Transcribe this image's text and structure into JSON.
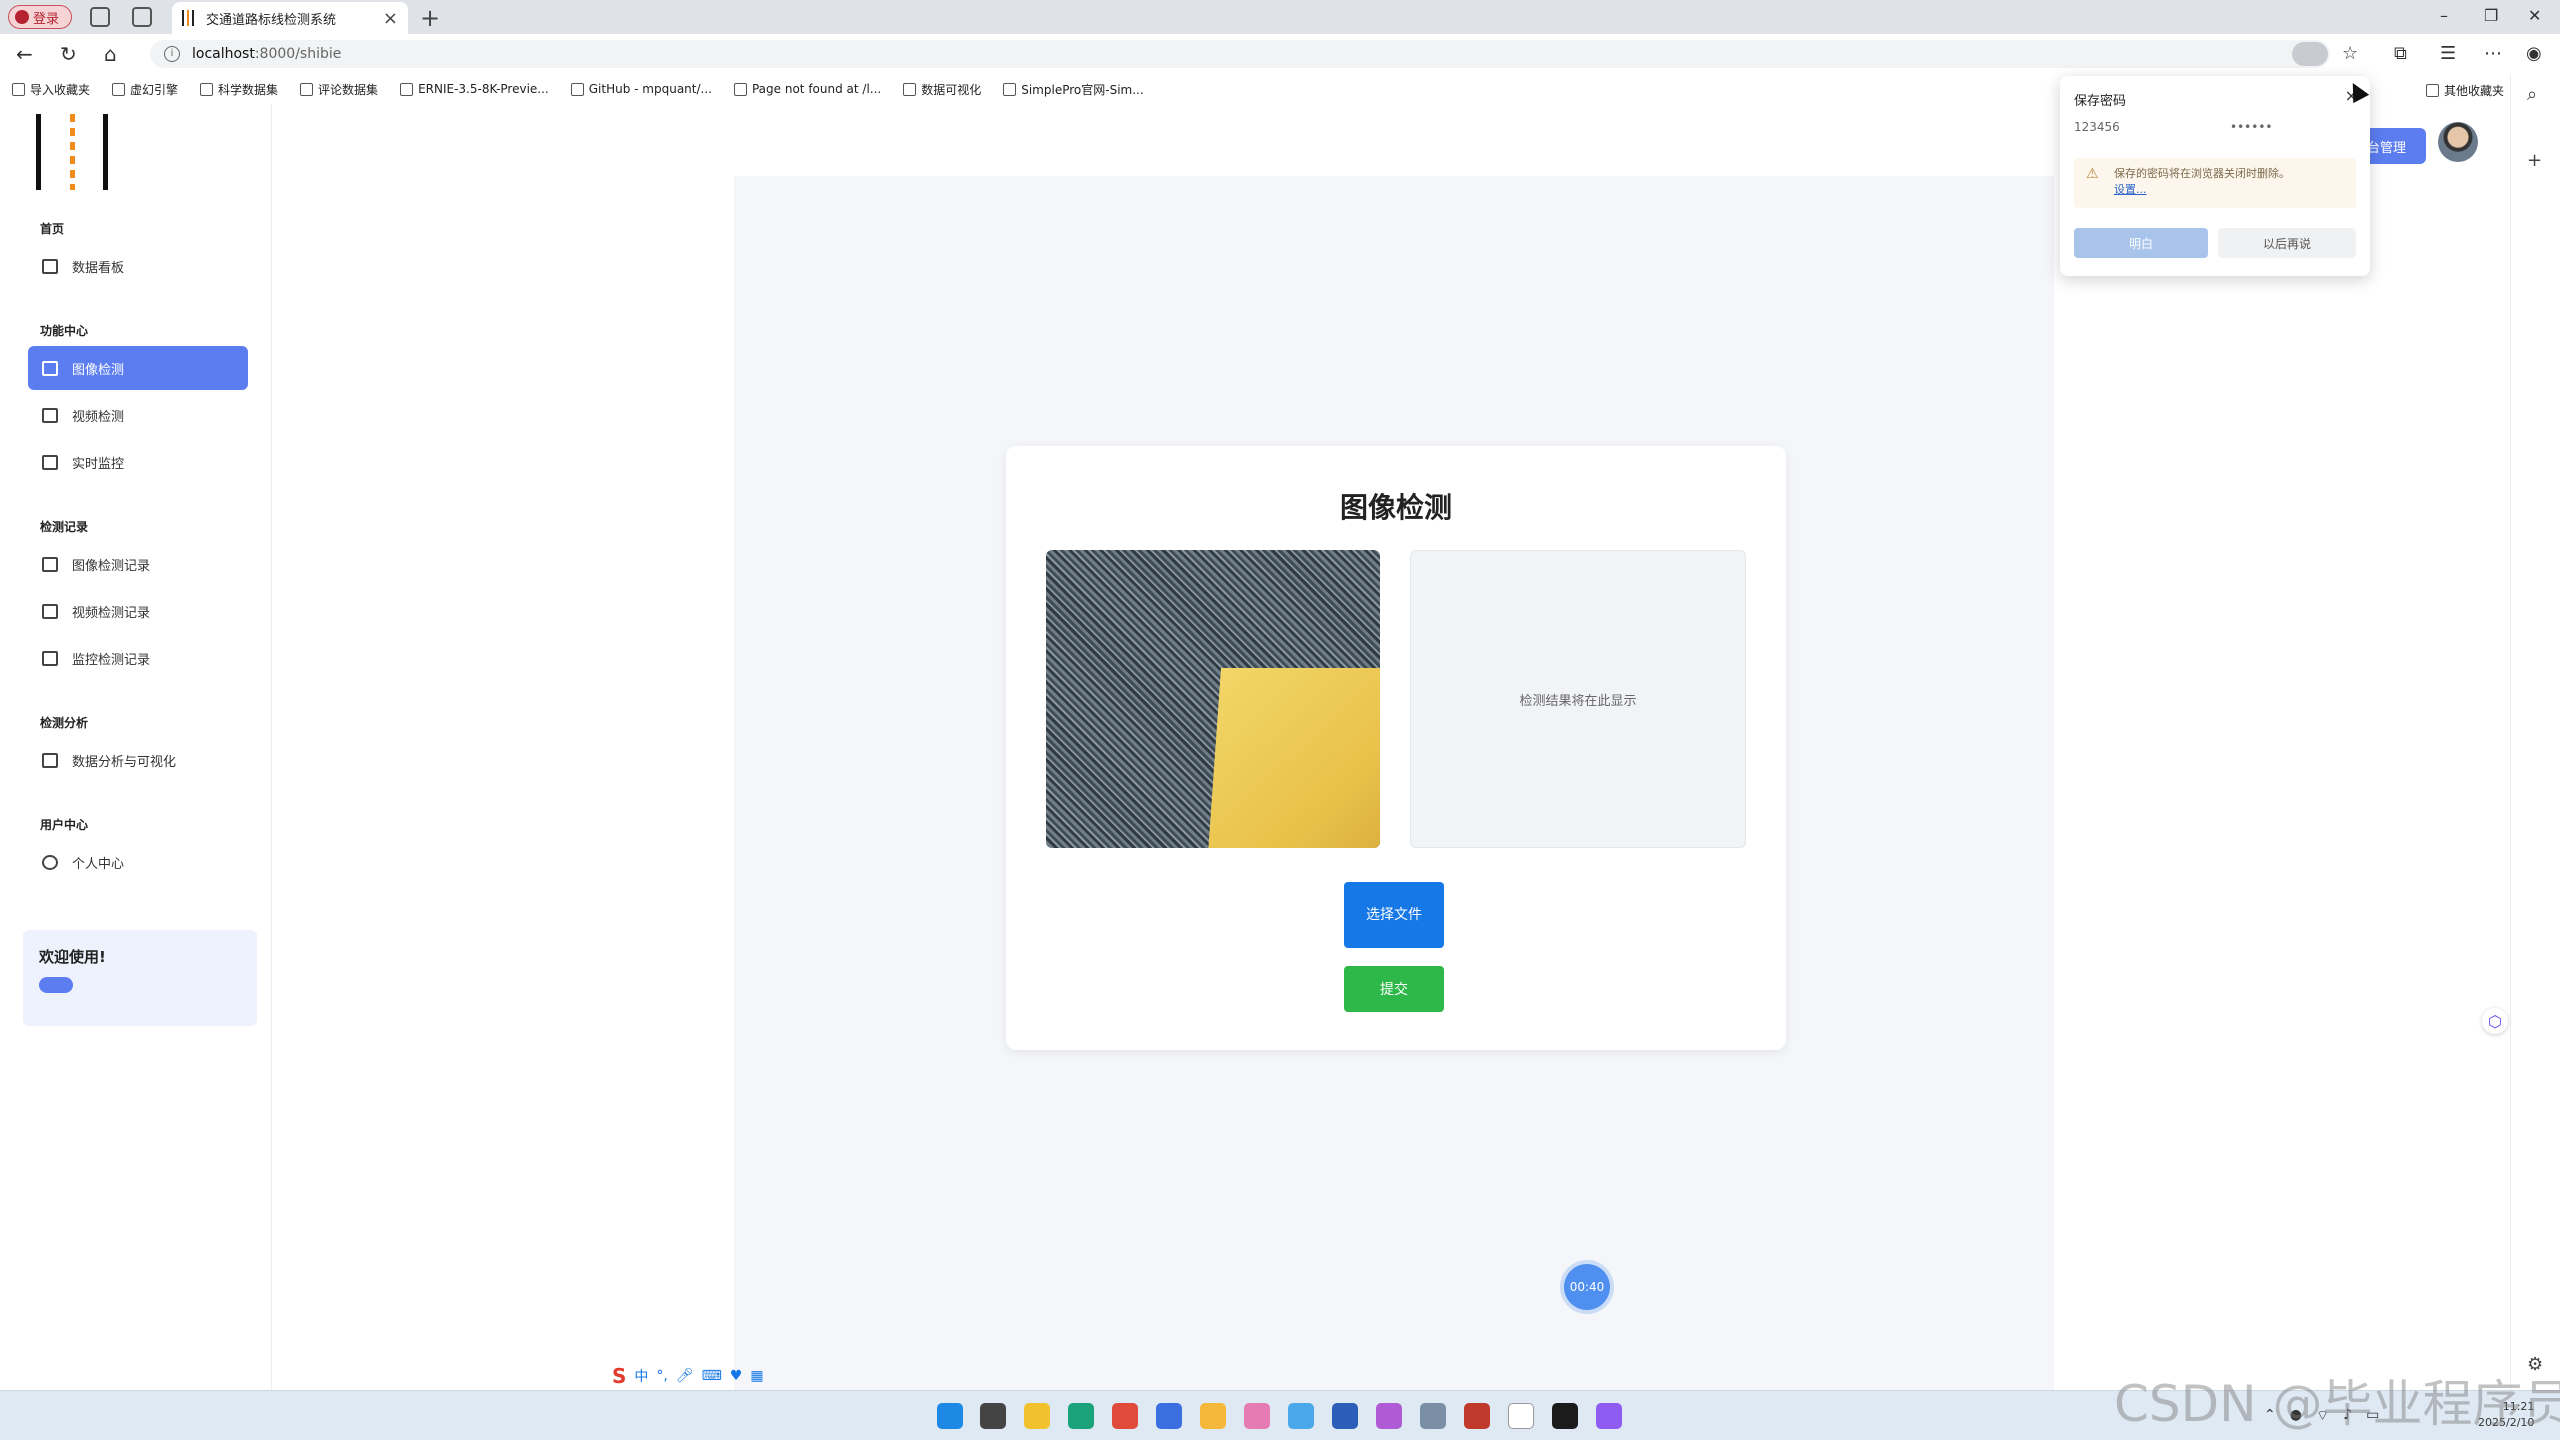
{
  "browser": {
    "profile_label": "登录",
    "tab_title": "交通道路标线检测系统",
    "url_host": "localhost",
    "url_path": ":8000/shibie",
    "bookmarks": [
      "导入收藏夹",
      "虚幻引擎",
      "科学数据集",
      "评论数据集",
      "ERNIE-3.5-8K-Previe...",
      "GitHub - mpquant/...",
      "Page not found at /l...",
      "数据可视化",
      "SimplePro官网-Sim..."
    ],
    "other_bookmarks": "其他收藏夹"
  },
  "sidebar": {
    "sections": [
      {
        "title": "首页",
        "items": [
          {
            "label": "数据看板"
          }
        ]
      },
      {
        "title": "功能中心",
        "items": [
          {
            "label": "图像检测"
          },
          {
            "label": "视频检测"
          },
          {
            "label": "实时监控"
          }
        ]
      },
      {
        "title": "检测记录",
        "items": [
          {
            "label": "图像检测记录"
          },
          {
            "label": "视频检测记录"
          },
          {
            "label": "监控检测记录"
          }
        ]
      },
      {
        "title": "检测分析",
        "items": [
          {
            "label": "数据分析与可视化"
          }
        ]
      },
      {
        "title": "用户中心",
        "items": [
          {
            "label": "个人中心"
          }
        ]
      }
    ],
    "active_item": "图像检测",
    "welcome": "欢迎使用!"
  },
  "header": {
    "admin_label": "后台管理"
  },
  "main": {
    "card_title": "图像检测",
    "result_placeholder": "检测结果将在此显示",
    "choose_file_label": "选择文件",
    "submit_label": "提交",
    "timer": "00:40"
  },
  "password_popup": {
    "title": "保存密码",
    "username": "123456",
    "password_mask": "••••••",
    "warning": "保存的密码将在浏览器关闭时删除。",
    "warning_link": "设置...",
    "ok_label": "明白",
    "later_label": "以后再说"
  },
  "ime_bar": {
    "mode": "中"
  },
  "taskbar": {
    "time": "11:21",
    "date": "2025/2/10"
  },
  "watermark": "CSDN @毕业程序员",
  "colors": {
    "accent": "#5b7df0",
    "primary_button": "#1677e6",
    "submit_button": "#2fb84a",
    "content_bg": "#f4f6fa"
  }
}
